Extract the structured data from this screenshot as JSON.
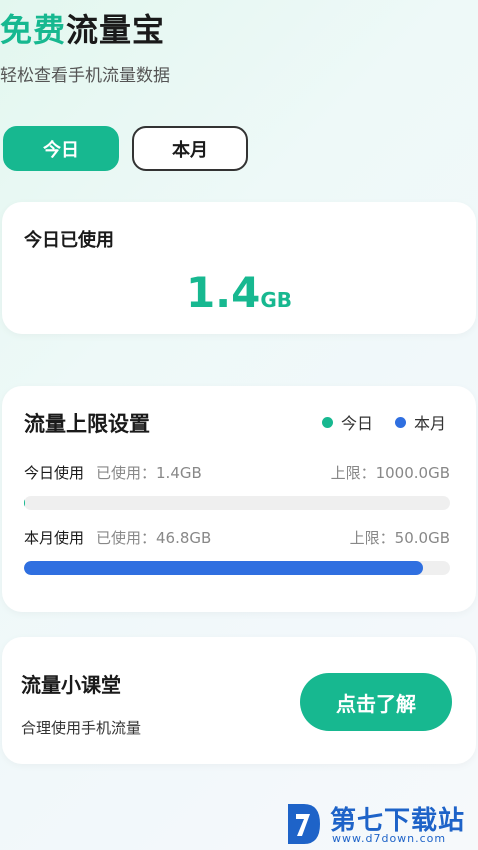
{
  "header": {
    "title_accent": "免费",
    "title_rest": "流量宝",
    "subtitle": "轻松查看手机流量数据"
  },
  "tabs": [
    {
      "label": "今日",
      "active": true
    },
    {
      "label": "本月",
      "active": false
    }
  ],
  "today_card": {
    "label": "今日已使用",
    "value": "1.4",
    "unit": "GB"
  },
  "limit_card": {
    "title": "流量上限设置",
    "legend": [
      {
        "label": "今日",
        "color": "#17b890"
      },
      {
        "label": "本月",
        "color": "#2f6fe0"
      }
    ],
    "rows": [
      {
        "name": "今日使用",
        "used": "已使用：1.4GB",
        "limit": "上限：1000.0GB",
        "progress": 0.0014,
        "color": "#17b890"
      },
      {
        "name": "本月使用",
        "used": "已使用：46.8GB",
        "limit": "上限：50.0GB",
        "progress": 0.936,
        "color": "#2f6fe0"
      }
    ]
  },
  "tip_card": {
    "title": "流量小课堂",
    "desc": "合理使用手机流量",
    "button": "点击了解"
  },
  "watermark": {
    "name": "第七下载站",
    "url": "www.d7down.com"
  },
  "colors": {
    "accent": "#17b890",
    "month": "#2f6fe0"
  }
}
